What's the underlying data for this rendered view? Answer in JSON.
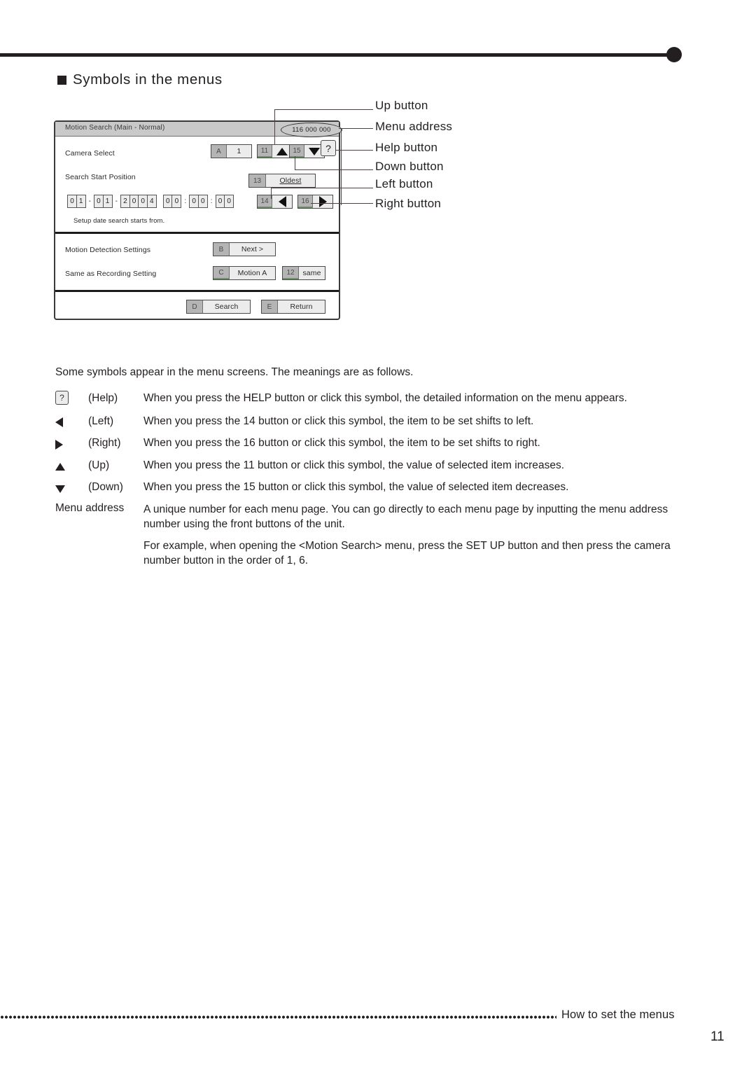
{
  "heading": {
    "bullet": "filled-square",
    "title": "Symbols in the menus"
  },
  "menu_mockup": {
    "titlebar": {
      "title": "Motion Search (Main - Normal)",
      "menu_address": "116 000 000"
    },
    "rows": [
      {
        "label": "Camera Select",
        "controls": [
          {
            "tag": "A",
            "body": "1"
          },
          {
            "tag": "11",
            "body": "up-triangle-icon"
          },
          {
            "tag": "15",
            "body": "down-triangle-icon"
          }
        ]
      },
      {
        "label": "Search Start Position",
        "controls": [
          {
            "tag": "13",
            "body": "Oldest"
          },
          {
            "tag": "14",
            "body": "left-triangle-icon"
          },
          {
            "tag": "16",
            "body": "right-triangle-icon"
          }
        ]
      },
      {
        "label": "Motion Detection Settings",
        "controls": [
          {
            "tag": "B",
            "body": "Next >"
          }
        ]
      },
      {
        "label": "Same as Recording Setting",
        "controls": [
          {
            "tag": "C",
            "body": "Motion A"
          },
          {
            "tag": "12",
            "body": "same"
          }
        ]
      }
    ],
    "help_symbol": "?",
    "datetime": {
      "day": [
        "0",
        "1"
      ],
      "month": [
        "0",
        "1"
      ],
      "year": [
        "2",
        "0",
        "0",
        "4"
      ],
      "hour": [
        "0",
        "0"
      ],
      "minute": [
        "0",
        "0"
      ],
      "second": [
        "0",
        "0"
      ],
      "date_separator": "-",
      "time_separator": ":"
    },
    "hint": "Setup date search starts from.",
    "footer_buttons": [
      {
        "tag": "D",
        "body": "Search"
      },
      {
        "tag": "E",
        "body": "Return"
      }
    ]
  },
  "callouts": [
    {
      "label": "Up button"
    },
    {
      "label": "Menu address"
    },
    {
      "label": "Help button"
    },
    {
      "label": "Down button"
    },
    {
      "label": "Left button"
    },
    {
      "label": "Right button"
    }
  ],
  "body": {
    "intro": "Some symbols appear in the menu screens. The meanings are as follows.",
    "legend": [
      {
        "symbol": "help-icon",
        "name": "(Help)",
        "desc": "When you press the HELP button or click this symbol, the detailed information on the menu appears."
      },
      {
        "symbol": "left-triangle-icon",
        "name": "(Left)",
        "desc": "When you press the 14 button or click this symbol, the item to be set shifts to left."
      },
      {
        "symbol": "right-triangle-icon",
        "name": "(Right)",
        "desc": "When you press the 16 button or click this symbol, the item to be set shifts to right."
      },
      {
        "symbol": "up-triangle-icon",
        "name": "(Up)",
        "desc": "When you press the 11 button or click this symbol, the value of selected item increases."
      },
      {
        "symbol": "down-triangle-icon",
        "name": "(Down)",
        "desc": "When you press the 15 button or click this symbol, the value of selected item decreases."
      }
    ],
    "menu_address_entry": {
      "name": "Menu address",
      "desc_1": "A unique number for each menu page. You can go directly to each menu page by inputting the menu address number using the front buttons of the unit.",
      "desc_2": "For example, when opening the <Motion Search> menu, press the SET UP button and then press the camera number button in the order of 1, 6."
    }
  },
  "footer": {
    "running_head": "How to set the menus",
    "page_number": "11"
  },
  "colors": {
    "ink": "#231f20",
    "titlebar_gray": "#c9c9c9",
    "button_face": "#ececed",
    "tag_gray": "#b4b4b4",
    "green_edge": "#6f8f6a"
  }
}
